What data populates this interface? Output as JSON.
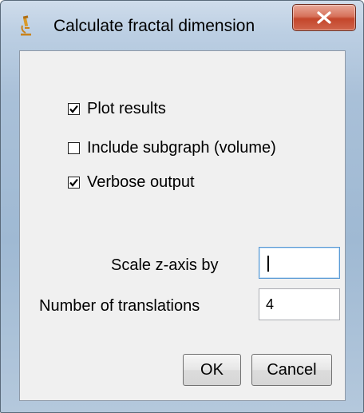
{
  "window": {
    "title": "Calculate fractal dimension",
    "app_icon": "microscope-icon",
    "close_icon": "close-icon",
    "colors": {
      "close_button": "#c4462b",
      "client_bg": "#f0f0f0",
      "frame": "#a9c0d8"
    }
  },
  "options": {
    "plot_results": {
      "label": "Plot results",
      "checked": true
    },
    "include_subgraph": {
      "label": "Include subgraph (volume)",
      "checked": false
    },
    "verbose_output": {
      "label": "Verbose output",
      "checked": true
    }
  },
  "fields": {
    "scale_z": {
      "label": "Scale z-axis by",
      "value": ""
    },
    "translations": {
      "label": "Number of translations",
      "value": "4"
    }
  },
  "buttons": {
    "ok": "OK",
    "cancel": "Cancel"
  }
}
